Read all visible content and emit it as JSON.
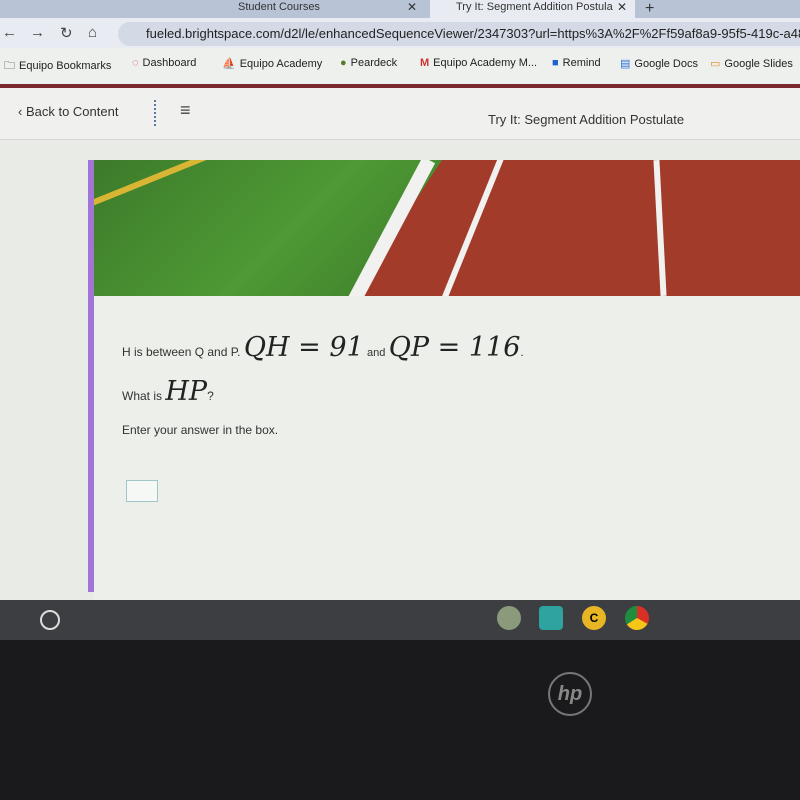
{
  "browser": {
    "tabs": [
      {
        "label": "Student Courses"
      },
      {
        "label": "Try It: Segment Addition Postula",
        "active": true
      }
    ],
    "new_tab": "+",
    "url": "fueled.brightspace.com/d2l/le/enhancedSequenceViewer/2347303?url=https%3A%2F%2Ff59af8a9-95f5-419c-a486-aee",
    "bookmarks": [
      {
        "label": "Equipo Bookmarks",
        "icon": "folder-icon"
      },
      {
        "label": "Dashboard",
        "icon": "dashboard-icon"
      },
      {
        "label": "Equipo Academy",
        "icon": "academy-icon"
      },
      {
        "label": "Peardeck",
        "icon": "pear-icon"
      },
      {
        "label": "Equipo Academy M...",
        "icon": "gmail-icon"
      },
      {
        "label": "Remind",
        "icon": "remind-icon"
      },
      {
        "label": "Google Docs",
        "icon": "docs-icon"
      },
      {
        "label": "Google Slides",
        "icon": "slides-icon"
      }
    ]
  },
  "header": {
    "back_label": "Back to Content",
    "title": "Try It: Segment Addition Postulate"
  },
  "question": {
    "line1_text": "H is between Q and P.",
    "expr1": "QH = 91",
    "and": "and",
    "expr2": "QP = 116",
    "period": ".",
    "line2_text": "What is",
    "expr3": "HP",
    "qmark": "?",
    "instruction": "Enter your answer in the box.",
    "answer_value": ""
  },
  "device": {
    "logo": "hp"
  },
  "colors": {
    "accent": "#a174d6",
    "header_line": "#7a2a2e"
  }
}
